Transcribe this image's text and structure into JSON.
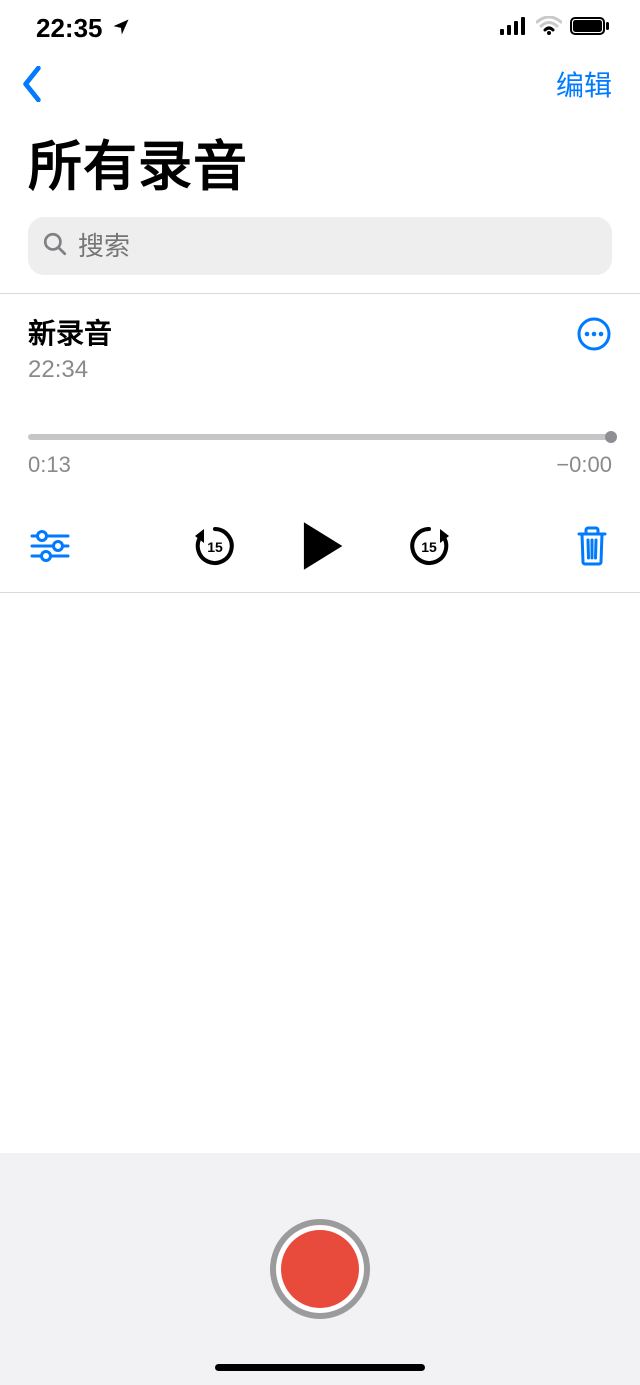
{
  "status_bar": {
    "time": "22:35"
  },
  "nav": {
    "edit_label": "编辑"
  },
  "header": {
    "title": "所有录音"
  },
  "search": {
    "placeholder": "搜索"
  },
  "recording": {
    "title": "新录音",
    "timestamp": "22:34",
    "elapsed": "0:13",
    "remaining": "−0:00"
  }
}
